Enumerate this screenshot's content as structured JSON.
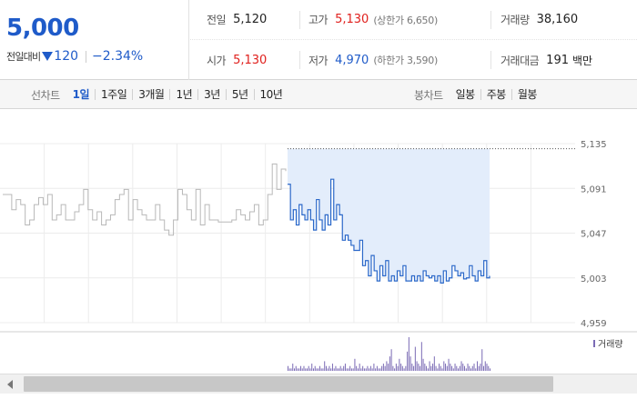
{
  "summary": {
    "current_price": "5,000",
    "change_label": "전일대비",
    "change_value": "120",
    "change_rate": "−2.34%",
    "prev_close": {
      "label": "전일",
      "value": "5,120"
    },
    "high": {
      "label": "고가",
      "value": "5,130",
      "sub": "(상한가 6,650)"
    },
    "volume": {
      "label": "거래량",
      "value": "38,160"
    },
    "open": {
      "label": "시가",
      "value": "5,130"
    },
    "low": {
      "label": "저가",
      "value": "4,970",
      "sub": "(하한가 3,590)"
    },
    "trade_amount": {
      "label": "거래대금",
      "value": "191",
      "unit": "백만"
    }
  },
  "toolbar": {
    "line_chart_label": "선차트",
    "periods": [
      "1일",
      "1주일",
      "3개월",
      "1년",
      "3년",
      "5년",
      "10년"
    ],
    "active_period": "1일",
    "candle_chart_label": "봉차트",
    "candle_periods": [
      "일봉",
      "주봉",
      "월봉"
    ]
  },
  "colors": {
    "down": "#1f5bc9",
    "up": "#e0201d",
    "prev_day_line": "#b8b8b8",
    "today_line": "#2b68c9",
    "today_fill": "#e3edfb",
    "volume_bar": "#7b6bb5"
  },
  "icons": {
    "change_direction": "down-triangle-icon",
    "scroll_left": "arrow-left-icon"
  },
  "chart_data": {
    "type": "line",
    "ylim": [
      4959,
      5135
    ],
    "y_ticks": [
      "5,135",
      "5,091",
      "5,047",
      "5,003",
      "4,959"
    ],
    "reference_value": 5130,
    "legend": "거래량",
    "series": [
      {
        "values": [
          5085,
          5085,
          5070,
          5080,
          5075,
          5055,
          5060,
          5075,
          5082,
          5075,
          5085,
          5060,
          5065,
          5075,
          5060,
          5060,
          5068,
          5075,
          5090,
          5070,
          5060,
          5068,
          5055,
          5060,
          5065,
          5080,
          5085,
          5090,
          5060,
          5080,
          5070,
          5065,
          5060,
          5060,
          5075,
          5060,
          5050,
          5045,
          5060,
          5090,
          5085,
          5070,
          5060,
          5090,
          5055,
          5075,
          5060,
          5060,
          5058,
          5058,
          5058,
          5060,
          5070,
          5065,
          5060,
          5068,
          5075,
          5055,
          5060,
          5085,
          5115,
          5090,
          5110,
          5108
        ]
      },
      {
        "values": [
          5095,
          5060,
          5070,
          5055,
          5075,
          5065,
          5060,
          5070,
          5060,
          5050,
          5080,
          5060,
          5050,
          5065,
          5055,
          5100,
          5060,
          5075,
          5065,
          5040,
          5045,
          5040,
          5035,
          5030,
          5030,
          5040,
          5015,
          5020,
          5005,
          5025,
          5010,
          5000,
          5015,
          5005,
          5020,
          5000,
          5005,
          5000,
          5010,
          5005,
          5015,
          5000,
          5000,
          5005,
          5000,
          5005,
          5000,
          5010,
          5005,
          5003,
          5005,
          5000,
          5005,
          4998,
          5010,
          5000,
          5003,
          5015,
          5010,
          5005,
          5008,
          5002,
          5003,
          5015,
          5005,
          5000,
          5010,
          5005,
          5020,
          5003,
          5005
        ]
      }
    ],
    "volume": [
      2,
      1,
      1,
      3,
      1,
      2,
      1,
      1,
      2,
      1,
      2,
      1,
      1,
      2,
      1,
      3,
      1,
      2,
      1,
      1,
      2,
      1,
      1,
      4,
      2,
      1,
      2,
      1,
      3,
      1,
      2,
      1,
      1,
      2,
      1,
      2,
      3,
      1,
      1,
      2,
      1,
      1,
      5,
      2,
      1,
      3,
      1,
      2,
      1,
      1,
      2,
      1,
      2,
      1,
      3,
      1,
      2,
      1,
      1,
      2,
      3,
      2,
      4,
      3,
      6,
      9,
      2,
      1,
      3,
      2,
      5,
      3,
      2,
      1,
      2,
      8,
      14,
      6,
      3,
      2,
      10,
      4,
      3,
      2,
      12,
      5,
      3,
      2,
      1,
      4,
      2,
      3,
      6,
      2,
      1,
      3,
      2,
      1,
      4,
      3,
      2,
      5,
      3,
      2,
      1,
      3,
      2,
      1,
      2,
      4,
      3,
      2,
      1,
      3,
      2,
      1,
      2,
      3,
      1,
      4,
      2,
      3,
      9,
      2,
      4,
      3,
      2,
      1
    ]
  }
}
